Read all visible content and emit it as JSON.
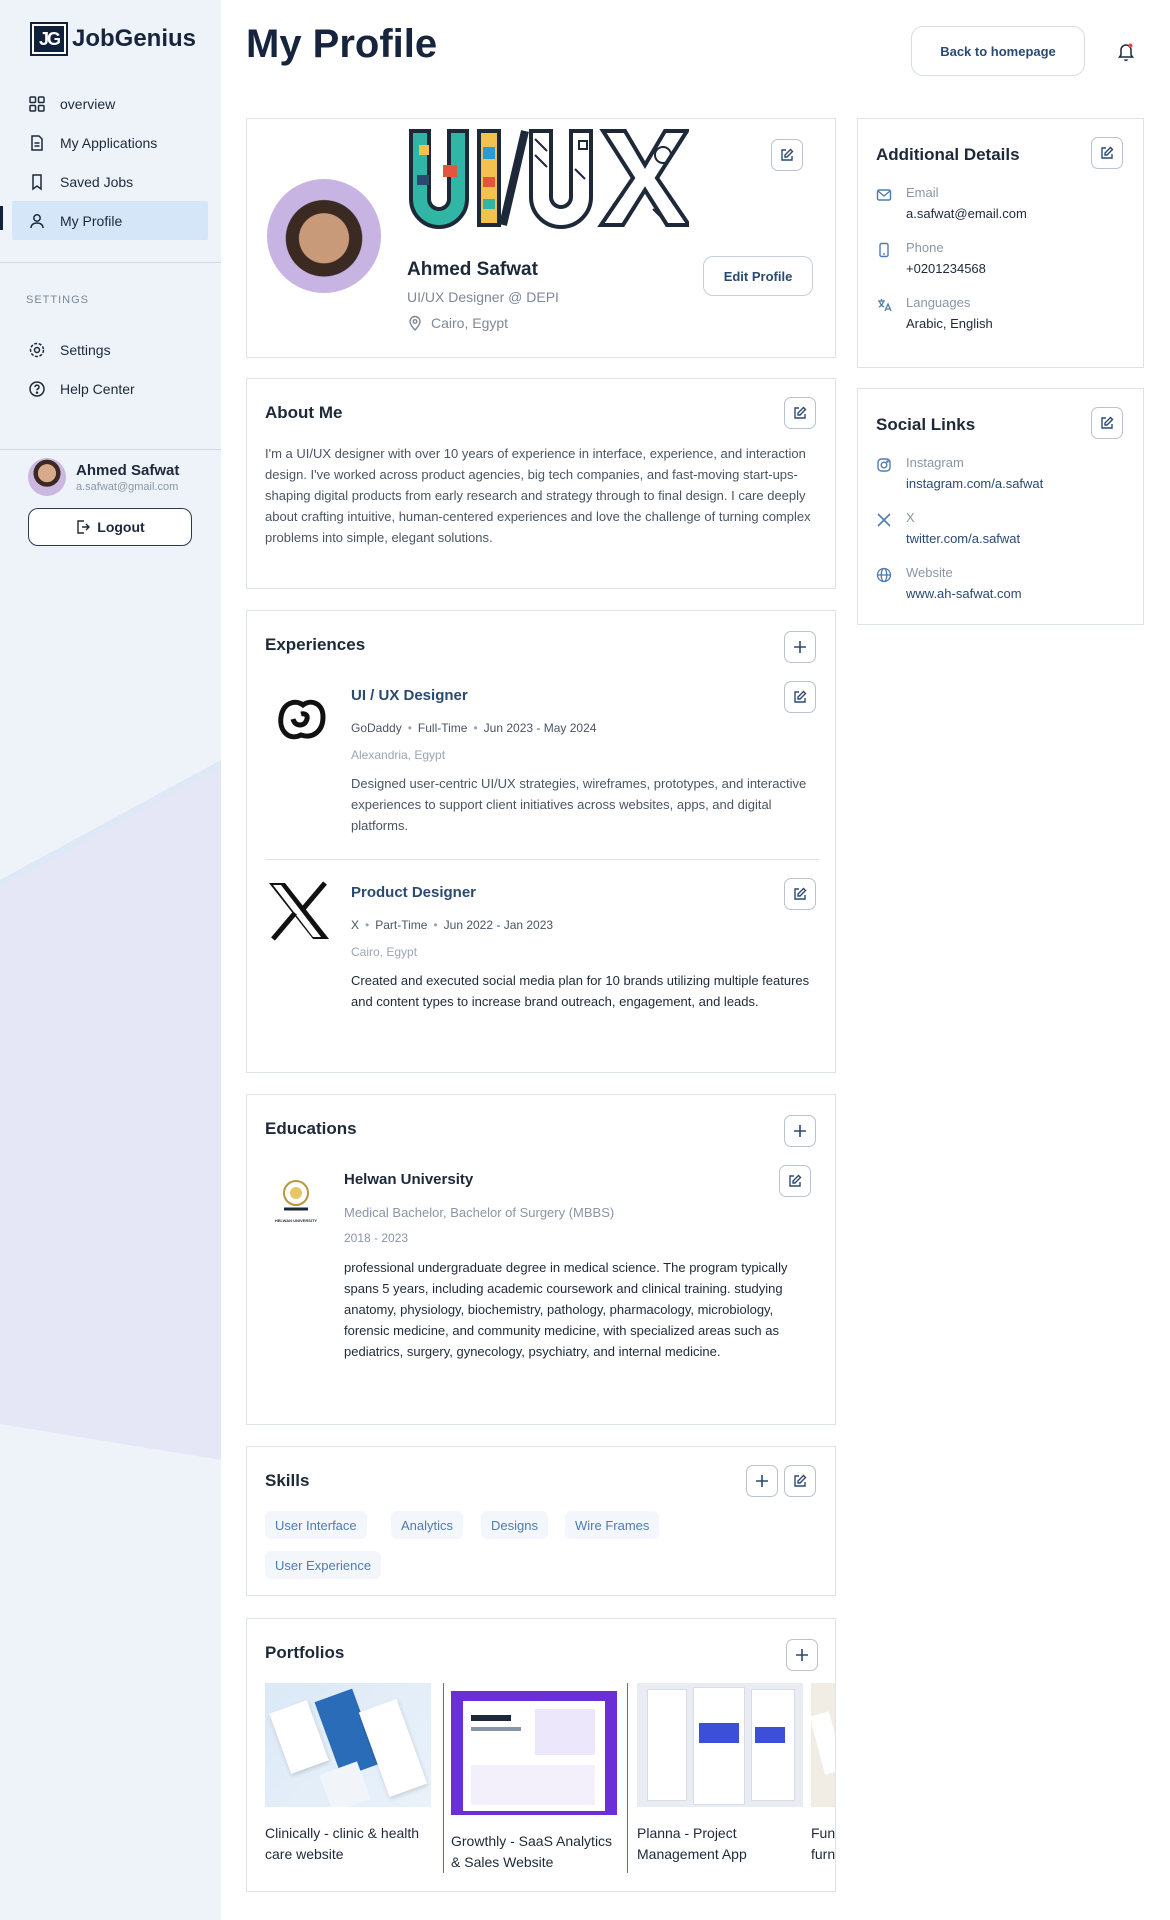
{
  "sidebar": {
    "logo_mark": "JG",
    "logo_text": "JobGenius",
    "nav": [
      "overview",
      "My Applications",
      "Saved Jobs",
      "My Profile"
    ],
    "settings_heading": "SETTINGS",
    "settings_nav": [
      "Settings",
      "Help Center"
    ],
    "user": {
      "name": "Ahmed Safwat",
      "email": "a.safwat@gmail.com"
    },
    "logout_label": "Logout"
  },
  "header": {
    "title": "My Profile",
    "back_label": "Back to homepage"
  },
  "profile": {
    "banner_text": "UI/UX",
    "name": "Ahmed Safwat",
    "role": "UI/UX Designer @ DEPI",
    "location": "Cairo, Egypt",
    "edit_label": "Edit Profile"
  },
  "about": {
    "title": "About Me",
    "text": "I'm a UI/UX designer with over 10 years of experience in interface, experience, and interaction design. I've worked across product agencies, big tech companies, and fast-moving start-ups-shaping digital products from early research and strategy through to final design. I care deeply about crafting intuitive, human-centered experiences and love the challenge of turning complex problems into simple, elegant solutions."
  },
  "experiences": {
    "title": "Experiences",
    "items": [
      {
        "title": "UI / UX Designer",
        "company": "GoDaddy",
        "type": "Full-Time",
        "dates": "Jun 2023 - May 2024",
        "location": "Alexandria, Egypt",
        "description": "Designed user-centric UI/UX strategies, wireframes, prototypes, and interactive experiences to support client initiatives across websites, apps, and digital platforms."
      },
      {
        "title": "Product Designer",
        "company": "X",
        "type": "Part-Time",
        "dates": "Jun 2022 - Jan 2023",
        "location": "Cairo, Egypt",
        "description": "Created and executed social media plan for 10 brands utilizing multiple features and content types to increase brand outreach, engagement, and leads."
      }
    ]
  },
  "educations": {
    "title": "Educations",
    "items": [
      {
        "school": "Helwan University",
        "logo_caption": "HELWAN UNIVERSITY",
        "degree": "Medical Bachelor, Bachelor of Surgery (MBBS)",
        "years": "2018 - 2023",
        "description": "professional undergraduate degree in medical science. The program typically spans 5 years, including academic coursework and clinical training. studying anatomy, physiology, biochemistry, pathology, pharmacology, microbiology, forensic medicine, and community medicine, with specialized areas such as pediatrics, surgery, gynecology, psychiatry, and internal medicine."
      }
    ]
  },
  "skills": {
    "title": "Skills",
    "items": [
      "User Interface",
      "Analytics",
      "Designs",
      "Wire Frames",
      "User Experience"
    ]
  },
  "portfolios": {
    "title": "Portfolios",
    "items": [
      {
        "caption": "Clinically - clinic & health care website"
      },
      {
        "caption": "Growthly - SaaS Analytics & Sales Website"
      },
      {
        "caption": "Planna - Project Management App"
      },
      {
        "caption": "Fun furn"
      }
    ]
  },
  "additional": {
    "title": "Additional Details",
    "items": [
      {
        "label": "Email",
        "value": "a.safwat@email.com",
        "icon": "mail-icon"
      },
      {
        "label": "Phone",
        "value": "+0201234568",
        "icon": "phone-icon"
      },
      {
        "label": "Languages",
        "value": "Arabic, English",
        "icon": "translate-icon"
      }
    ]
  },
  "social": {
    "title": "Social Links",
    "items": [
      {
        "label": "Instagram",
        "value": "instagram.com/a.safwat",
        "icon": "instagram-icon"
      },
      {
        "label": "X",
        "value": "twitter.com/a.safwat",
        "icon": "x-icon"
      },
      {
        "label": "Website",
        "value": "www.ah-safwat.com",
        "icon": "globe-icon"
      }
    ]
  },
  "colors": {
    "primary": "#16253d",
    "accent": "#2a4a72",
    "sidebar_bg": "#eef3fa",
    "active_nav": "#d5e6f8"
  }
}
